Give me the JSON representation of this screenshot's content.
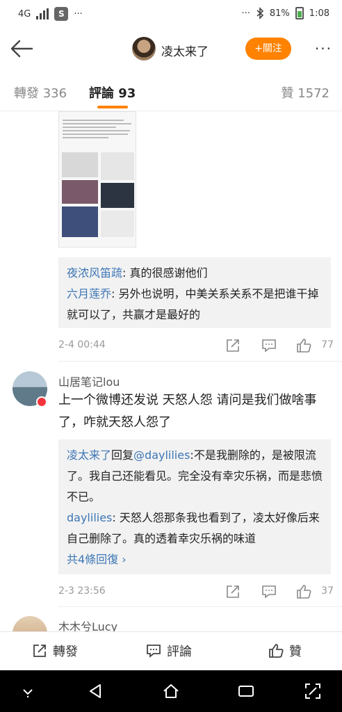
{
  "status": {
    "network": "4G",
    "app_badge": "S",
    "dots": "···",
    "battery": "81%",
    "time": "1:08"
  },
  "header": {
    "name": "凌太来了",
    "follow_label": "+關注",
    "more": "···"
  },
  "tabs": {
    "repost": "轉發 336",
    "comments": "評論 93",
    "likes": "贊 1572"
  },
  "thread1": {
    "replies": [
      {
        "user": "夜浓风笛疏",
        "text": ": 真的很感谢他们"
      },
      {
        "user": "六月莲乔",
        "text": ": 另外也说明，中美关系关系不是把谁干掉就可以了，共赢才是最好的"
      }
    ],
    "time": "2-4 00:44",
    "likes": "77"
  },
  "comment2": {
    "user": "山居笔记lou",
    "text": "上一个微博还发说  天怒人怨  请问是我们做啥事了，咋就天怒人怨了",
    "replies": [
      {
        "user": "凌太来了",
        "mid": "回复",
        "mention": "@daylilies",
        "text": ":不是我删除的，是被限流了。我自己还能看见。完全没有幸灾乐祸，而是悲愤不已。"
      },
      {
        "user": "daylilies",
        "text": ": 天怒人怨那条我也看到了，凌太好像后来自己删除了。真的透着幸灾乐祸的味道"
      }
    ],
    "more_replies": "共4條回復 ›",
    "time": "2-3 23:56",
    "likes": "37"
  },
  "comment3": {
    "user": "木木兮Lucy"
  },
  "actions": {
    "repost": "轉發",
    "comment": "評論",
    "like": "贊"
  },
  "colors": {
    "accent": "#ff8200",
    "link": "#3d76b5"
  }
}
